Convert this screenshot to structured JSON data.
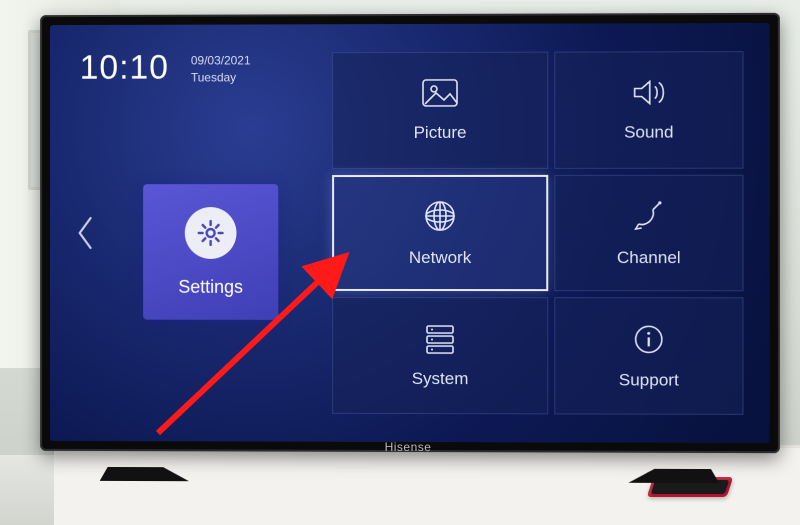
{
  "clock": {
    "time": "10:10",
    "date": "09/03/2021",
    "weekday": "Tuesday"
  },
  "sidebar": {
    "active_tile": {
      "label": "Settings",
      "icon": "gear-icon"
    }
  },
  "tiles": [
    {
      "id": "picture",
      "label": "Picture",
      "icon": "picture-icon",
      "selected": false
    },
    {
      "id": "sound",
      "label": "Sound",
      "icon": "sound-icon",
      "selected": false
    },
    {
      "id": "network",
      "label": "Network",
      "icon": "globe-icon",
      "selected": true
    },
    {
      "id": "channel",
      "label": "Channel",
      "icon": "satellite-icon",
      "selected": false
    },
    {
      "id": "system",
      "label": "System",
      "icon": "server-icon",
      "selected": false
    },
    {
      "id": "support",
      "label": "Support",
      "icon": "info-icon",
      "selected": false
    }
  ],
  "brand": "Hisense",
  "colors": {
    "accent": "#4f4cc9",
    "screen_bg": "#12205a",
    "tile_border": "#e7ebfa"
  }
}
